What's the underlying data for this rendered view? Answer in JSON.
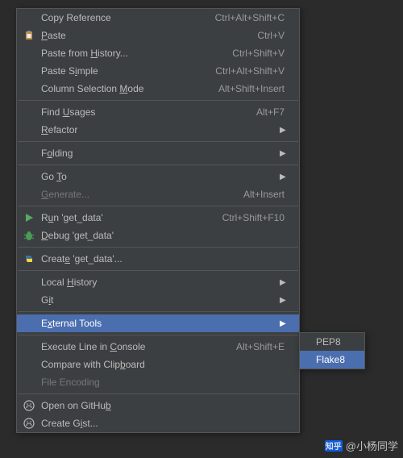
{
  "menu": {
    "copy_reference": {
      "label": "Copy Reference",
      "shortcut": "Ctrl+Alt+Shift+C"
    },
    "paste": {
      "label_pre": "",
      "label_u": "P",
      "label_post": "aste",
      "shortcut": "Ctrl+V"
    },
    "paste_history": {
      "label_pre": "Paste from ",
      "label_u": "H",
      "label_post": "istory...",
      "shortcut": "Ctrl+Shift+V"
    },
    "paste_simple": {
      "label_pre": "Paste S",
      "label_u": "i",
      "label_post": "mple",
      "shortcut": "Ctrl+Alt+Shift+V"
    },
    "column_mode": {
      "label_pre": "Column Selection ",
      "label_u": "M",
      "label_post": "ode",
      "shortcut": "Alt+Shift+Insert"
    },
    "find_usages": {
      "label_pre": "Find ",
      "label_u": "U",
      "label_post": "sages",
      "shortcut": "Alt+F7"
    },
    "refactor": {
      "label_pre": "",
      "label_u": "R",
      "label_post": "efactor"
    },
    "folding": {
      "label_pre": "F",
      "label_u": "o",
      "label_post": "lding"
    },
    "goto": {
      "label_pre": "Go ",
      "label_u": "T",
      "label_post": "o"
    },
    "generate": {
      "label_pre": "",
      "label_u": "G",
      "label_post": "enerate...",
      "shortcut": "Alt+Insert"
    },
    "run": {
      "label_pre": "R",
      "label_u": "u",
      "label_post": "n 'get_data'",
      "shortcut": "Ctrl+Shift+F10"
    },
    "debug": {
      "label_pre": "",
      "label_u": "D",
      "label_post": "ebug 'get_data'"
    },
    "create": {
      "label_pre": "Creat",
      "label_u": "e",
      "label_post": " 'get_data'..."
    },
    "local_history": {
      "label_pre": "Local ",
      "label_u": "H",
      "label_post": "istory"
    },
    "git": {
      "label_pre": "G",
      "label_u": "i",
      "label_post": "t"
    },
    "external_tools": {
      "label_pre": "E",
      "label_u": "x",
      "label_post": "ternal Tools"
    },
    "exec_console": {
      "label_pre": "Execute Line in ",
      "label_u": "C",
      "label_post": "onsole",
      "shortcut": "Alt+Shift+E"
    },
    "compare_clipboard": {
      "label_pre": "Compare with Clip",
      "label_u": "b",
      "label_post": "oard"
    },
    "file_encoding": {
      "label": "File Encoding"
    },
    "open_github": {
      "label_pre": "Open on GitHu",
      "label_u": "b",
      "label_post": ""
    },
    "create_gist": {
      "label_pre": "Create G",
      "label_u": "i",
      "label_post": "st..."
    }
  },
  "submenu": {
    "pep8": {
      "label": "PEP8"
    },
    "flake8": {
      "label": "Flake8"
    }
  },
  "watermark": {
    "brand": "知乎",
    "text": "@小杨同学"
  }
}
